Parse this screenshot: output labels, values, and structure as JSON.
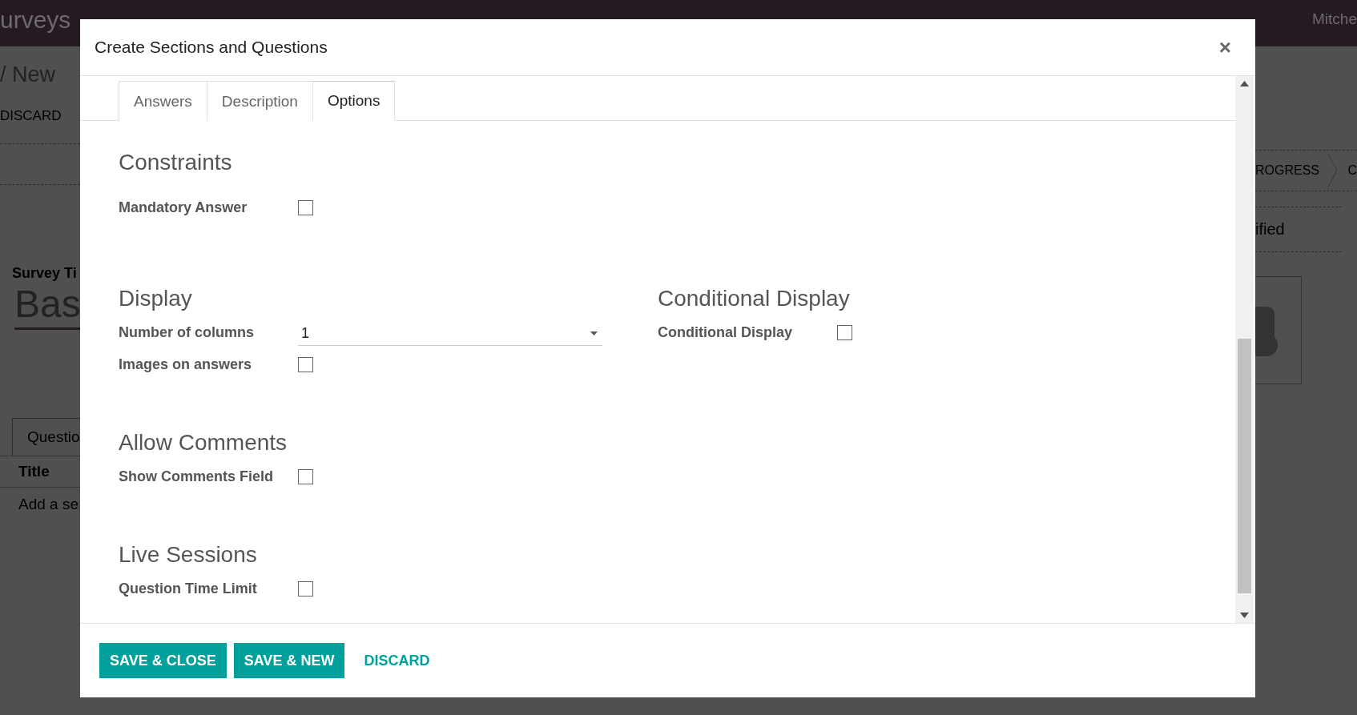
{
  "background": {
    "app_name": "urveys",
    "user": "Mitche",
    "breadcrumb": "/ New",
    "discard": "DISCARD",
    "stage": "ROGRESS",
    "stage_next": "C",
    "side_text": "ified",
    "field_label": "Survey Ti",
    "title_value": "Bas",
    "notebook_tab": "Questio",
    "column": "Title",
    "add_line": "Add a se"
  },
  "dialog": {
    "title": "Create Sections and Questions",
    "close": "×",
    "tabs": [
      {
        "label": "Answers",
        "selected": false
      },
      {
        "label": "Description",
        "selected": false
      },
      {
        "label": "Options",
        "selected": true
      }
    ],
    "rows": [
      {
        "sections": [
          {
            "title": "Constraints",
            "fields": [
              {
                "kind": "checkbox",
                "label": "Mandatory Answer",
                "checked": false
              }
            ]
          }
        ]
      },
      {
        "sections": [
          {
            "title": "Display",
            "fields": [
              {
                "kind": "select",
                "label": "Number of columns",
                "value": "1"
              },
              {
                "kind": "checkbox",
                "label": "Images on answers",
                "checked": false
              }
            ]
          },
          {
            "title": "Conditional Display",
            "fields": [
              {
                "kind": "checkbox",
                "label": "Conditional Display",
                "checked": false
              }
            ]
          }
        ]
      },
      {
        "sections": [
          {
            "title": "Allow Comments",
            "fields": [
              {
                "kind": "checkbox",
                "label": "Show Comments Field",
                "checked": false
              }
            ]
          }
        ]
      },
      {
        "sections": [
          {
            "title": "Live Sessions",
            "fields": [
              {
                "kind": "checkbox",
                "label": "Question Time Limit",
                "checked": false
              }
            ]
          }
        ]
      }
    ],
    "buttons": [
      {
        "label": "SAVE & CLOSE",
        "kind": "primary"
      },
      {
        "label": "SAVE & NEW",
        "kind": "primary"
      },
      {
        "label": "DISCARD",
        "kind": "link"
      }
    ]
  }
}
